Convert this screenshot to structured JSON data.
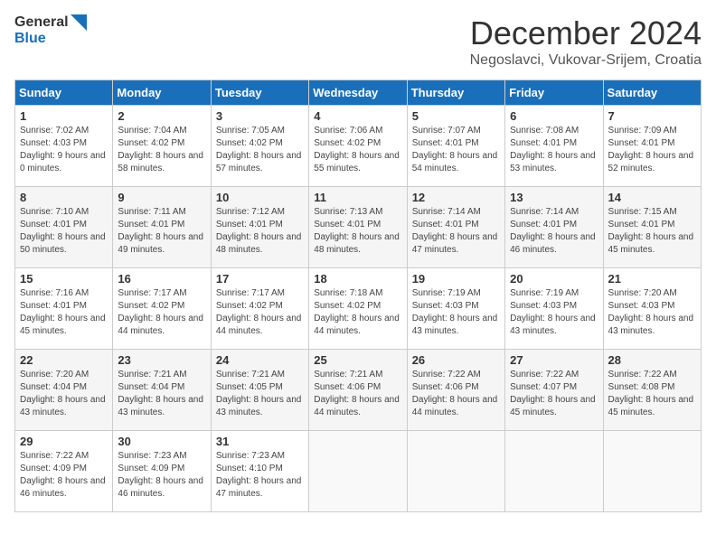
{
  "header": {
    "logo_general": "General",
    "logo_blue": "Blue",
    "month_title": "December 2024",
    "location": "Negoslavci, Vukovar-Srijem, Croatia"
  },
  "weekdays": [
    "Sunday",
    "Monday",
    "Tuesday",
    "Wednesday",
    "Thursday",
    "Friday",
    "Saturday"
  ],
  "weeks": [
    [
      {
        "day": "1",
        "sunrise": "7:02 AM",
        "sunset": "4:03 PM",
        "daylight": "9 hours and 0 minutes."
      },
      {
        "day": "2",
        "sunrise": "7:04 AM",
        "sunset": "4:02 PM",
        "daylight": "8 hours and 58 minutes."
      },
      {
        "day": "3",
        "sunrise": "7:05 AM",
        "sunset": "4:02 PM",
        "daylight": "8 hours and 57 minutes."
      },
      {
        "day": "4",
        "sunrise": "7:06 AM",
        "sunset": "4:02 PM",
        "daylight": "8 hours and 55 minutes."
      },
      {
        "day": "5",
        "sunrise": "7:07 AM",
        "sunset": "4:01 PM",
        "daylight": "8 hours and 54 minutes."
      },
      {
        "day": "6",
        "sunrise": "7:08 AM",
        "sunset": "4:01 PM",
        "daylight": "8 hours and 53 minutes."
      },
      {
        "day": "7",
        "sunrise": "7:09 AM",
        "sunset": "4:01 PM",
        "daylight": "8 hours and 52 minutes."
      }
    ],
    [
      {
        "day": "8",
        "sunrise": "7:10 AM",
        "sunset": "4:01 PM",
        "daylight": "8 hours and 50 minutes."
      },
      {
        "day": "9",
        "sunrise": "7:11 AM",
        "sunset": "4:01 PM",
        "daylight": "8 hours and 49 minutes."
      },
      {
        "day": "10",
        "sunrise": "7:12 AM",
        "sunset": "4:01 PM",
        "daylight": "8 hours and 48 minutes."
      },
      {
        "day": "11",
        "sunrise": "7:13 AM",
        "sunset": "4:01 PM",
        "daylight": "8 hours and 48 minutes."
      },
      {
        "day": "12",
        "sunrise": "7:14 AM",
        "sunset": "4:01 PM",
        "daylight": "8 hours and 47 minutes."
      },
      {
        "day": "13",
        "sunrise": "7:14 AM",
        "sunset": "4:01 PM",
        "daylight": "8 hours and 46 minutes."
      },
      {
        "day": "14",
        "sunrise": "7:15 AM",
        "sunset": "4:01 PM",
        "daylight": "8 hours and 45 minutes."
      }
    ],
    [
      {
        "day": "15",
        "sunrise": "7:16 AM",
        "sunset": "4:01 PM",
        "daylight": "8 hours and 45 minutes."
      },
      {
        "day": "16",
        "sunrise": "7:17 AM",
        "sunset": "4:02 PM",
        "daylight": "8 hours and 44 minutes."
      },
      {
        "day": "17",
        "sunrise": "7:17 AM",
        "sunset": "4:02 PM",
        "daylight": "8 hours and 44 minutes."
      },
      {
        "day": "18",
        "sunrise": "7:18 AM",
        "sunset": "4:02 PM",
        "daylight": "8 hours and 44 minutes."
      },
      {
        "day": "19",
        "sunrise": "7:19 AM",
        "sunset": "4:03 PM",
        "daylight": "8 hours and 43 minutes."
      },
      {
        "day": "20",
        "sunrise": "7:19 AM",
        "sunset": "4:03 PM",
        "daylight": "8 hours and 43 minutes."
      },
      {
        "day": "21",
        "sunrise": "7:20 AM",
        "sunset": "4:03 PM",
        "daylight": "8 hours and 43 minutes."
      }
    ],
    [
      {
        "day": "22",
        "sunrise": "7:20 AM",
        "sunset": "4:04 PM",
        "daylight": "8 hours and 43 minutes."
      },
      {
        "day": "23",
        "sunrise": "7:21 AM",
        "sunset": "4:04 PM",
        "daylight": "8 hours and 43 minutes."
      },
      {
        "day": "24",
        "sunrise": "7:21 AM",
        "sunset": "4:05 PM",
        "daylight": "8 hours and 43 minutes."
      },
      {
        "day": "25",
        "sunrise": "7:21 AM",
        "sunset": "4:06 PM",
        "daylight": "8 hours and 44 minutes."
      },
      {
        "day": "26",
        "sunrise": "7:22 AM",
        "sunset": "4:06 PM",
        "daylight": "8 hours and 44 minutes."
      },
      {
        "day": "27",
        "sunrise": "7:22 AM",
        "sunset": "4:07 PM",
        "daylight": "8 hours and 45 minutes."
      },
      {
        "day": "28",
        "sunrise": "7:22 AM",
        "sunset": "4:08 PM",
        "daylight": "8 hours and 45 minutes."
      }
    ],
    [
      {
        "day": "29",
        "sunrise": "7:22 AM",
        "sunset": "4:09 PM",
        "daylight": "8 hours and 46 minutes."
      },
      {
        "day": "30",
        "sunrise": "7:23 AM",
        "sunset": "4:09 PM",
        "daylight": "8 hours and 46 minutes."
      },
      {
        "day": "31",
        "sunrise": "7:23 AM",
        "sunset": "4:10 PM",
        "daylight": "8 hours and 47 minutes."
      },
      null,
      null,
      null,
      null
    ]
  ]
}
